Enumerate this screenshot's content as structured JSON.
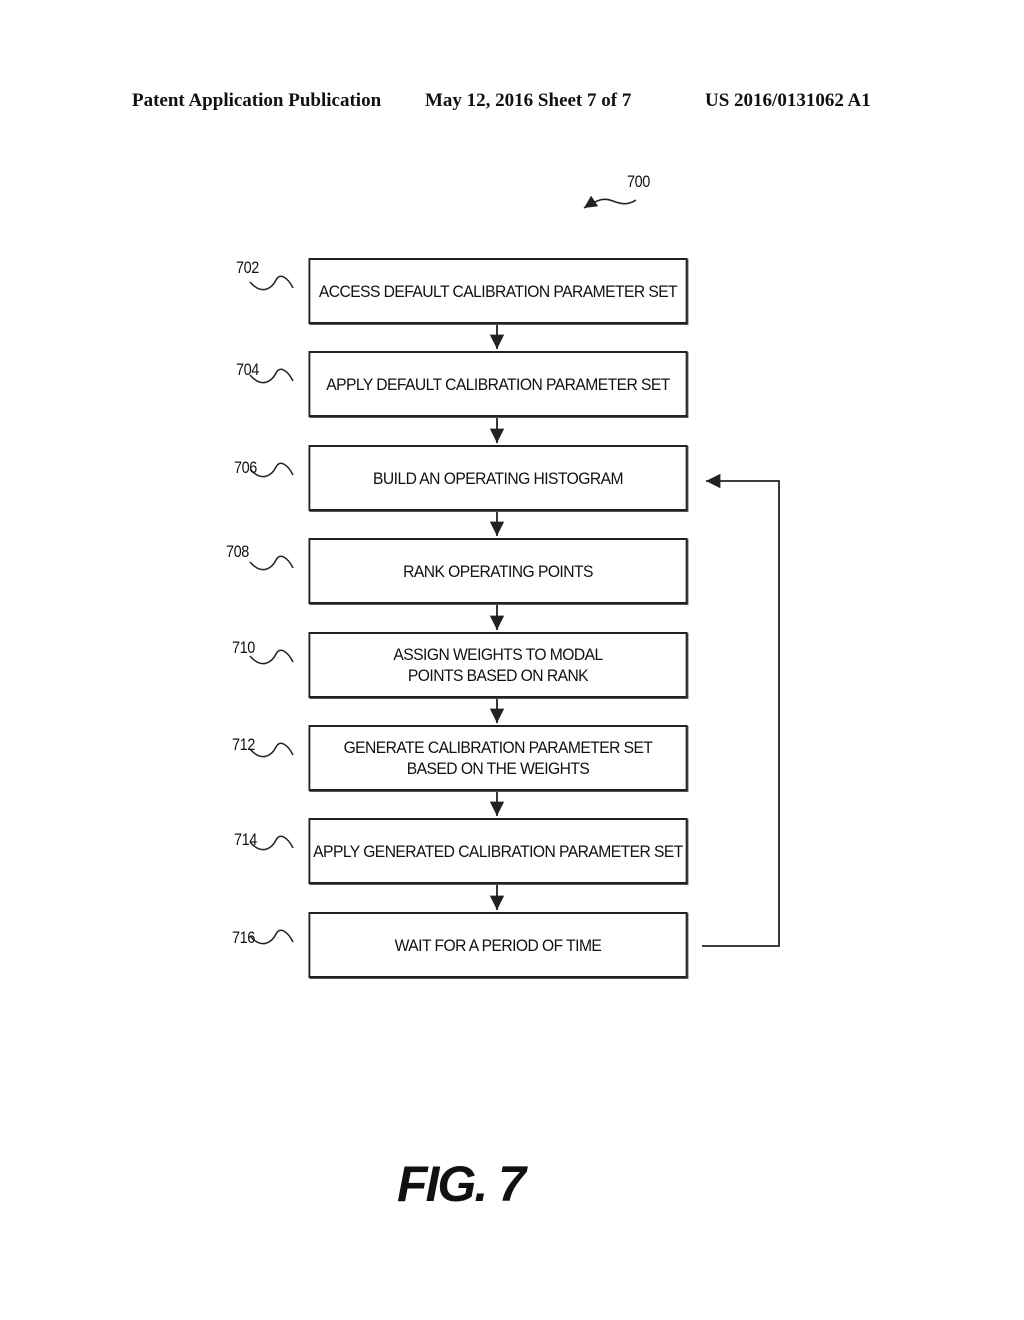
{
  "header": {
    "left": "Patent Application Publication",
    "middle": "May 12, 2016   Sheet 7 of 7",
    "right": "US 2016/0131062 A1"
  },
  "diagram": {
    "figure_ref": "700",
    "steps": [
      {
        "ref": "702",
        "lines": [
          "ACCESS DEFAULT CALIBRATION PARAMETER SET"
        ]
      },
      {
        "ref": "704",
        "lines": [
          "APPLY DEFAULT CALIBRATION PARAMETER SET"
        ]
      },
      {
        "ref": "706",
        "lines": [
          "BUILD AN OPERATING HISTOGRAM"
        ]
      },
      {
        "ref": "708",
        "lines": [
          "RANK OPERATING POINTS"
        ]
      },
      {
        "ref": "710",
        "lines": [
          "ASSIGN WEIGHTS TO MODAL",
          "POINTS BASED ON RANK"
        ]
      },
      {
        "ref": "712",
        "lines": [
          "GENERATE CALIBRATION PARAMETER SET",
          "BASED ON THE WEIGHTS"
        ]
      },
      {
        "ref": "714",
        "lines": [
          "APPLY GENERATED CALIBRATION PARAMETER SET"
        ]
      },
      {
        "ref": "716",
        "lines": [
          "WAIT FOR A PERIOD OF TIME"
        ]
      }
    ],
    "loop": {
      "from": "716",
      "to": "706"
    },
    "caption": "FIG. 7"
  }
}
